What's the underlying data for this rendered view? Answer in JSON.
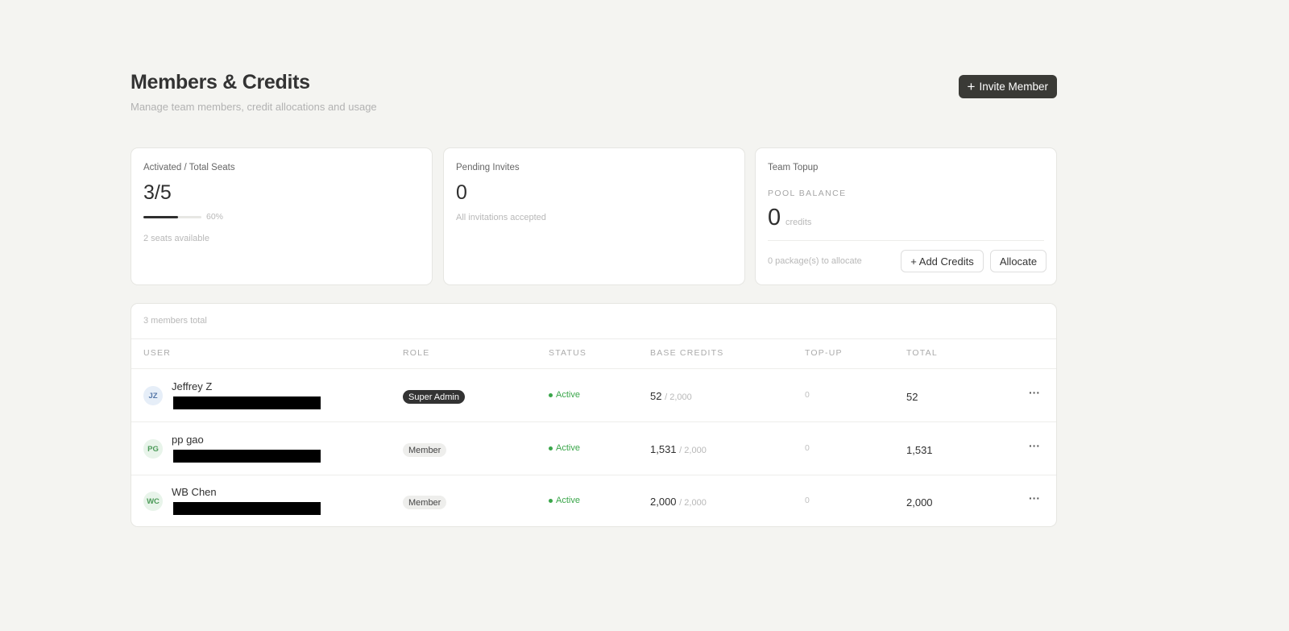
{
  "header": {
    "title": "Members & Credits",
    "subtitle": "Manage team members, credit allocations and usage",
    "invite_button": "Invite Member"
  },
  "seats_card": {
    "label": "Activated / Total Seats",
    "value": "3/5",
    "progress_fraction": 0.6,
    "progress_label": "60%",
    "note": "2 seats available"
  },
  "invites_card": {
    "label": "Pending Invites",
    "value": "0",
    "note": "All invitations accepted"
  },
  "topup_card": {
    "label": "Team Topup",
    "pool_label": "POOL BALANCE",
    "pool_value": "0",
    "pool_unit": "credits",
    "packages_note": "0 package(s) to allocate",
    "add_credits_button": "+ Add Credits",
    "allocate_button": "Allocate"
  },
  "table": {
    "total_label": "3 members total",
    "columns": [
      "USER",
      "ROLE",
      "STATUS",
      "BASE CREDITS",
      "TOP-UP",
      "TOTAL"
    ],
    "rows": [
      {
        "initials": "JZ",
        "name": "Jeffrey Z",
        "role": "Super Admin",
        "status": "Active",
        "base": "52",
        "base_of": "/ 2,000",
        "topup": "0",
        "total": "52",
        "avatar_bg": "#e6eef8",
        "avatar_fg": "#5577a8"
      },
      {
        "initials": "PG",
        "name": "pp gao",
        "role": "Member",
        "status": "Active",
        "base": "1,531",
        "base_of": "/ 2,000",
        "topup": "0",
        "total": "1,531",
        "avatar_bg": "#e8f4ea",
        "avatar_fg": "#4b9a58"
      },
      {
        "initials": "WC",
        "name": "WB Chen",
        "role": "Member",
        "status": "Active",
        "base": "2,000",
        "base_of": "/ 2,000",
        "topup": "0",
        "total": "2,000",
        "avatar_bg": "#e8f4ea",
        "avatar_fg": "#4b9a58"
      }
    ]
  },
  "colors": {
    "background": "#f4f4f1",
    "dark_button": "#3a3a36",
    "active_green": "#3aa64a"
  }
}
